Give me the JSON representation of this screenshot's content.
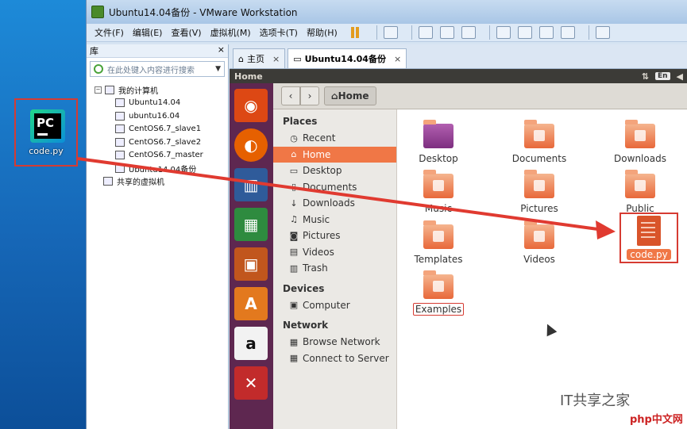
{
  "desktop": {
    "icon_label": "code.py",
    "icon_text": "PC"
  },
  "window": {
    "title": "Ubuntu14.04备份 - VMware Workstation"
  },
  "menubar": {
    "items": [
      "文件(F)",
      "编辑(E)",
      "查看(V)",
      "虚拟机(M)",
      "选项卡(T)",
      "帮助(H)"
    ]
  },
  "library": {
    "title": "库",
    "close": "×",
    "search_placeholder": "在此处键入内容进行搜索",
    "root": "我的计算机",
    "vms": [
      "Ubuntu14.04",
      "ubuntu16.04",
      "CentOS6.7_slave1",
      "CentOS6.7_slave2",
      "CentOS6.7_master",
      "Ubuntu14.04备份"
    ],
    "shared": "共享的虚拟机"
  },
  "tabs": [
    {
      "label": "主页",
      "close": "×"
    },
    {
      "label": "Ubuntu14.04备份",
      "close": "×"
    }
  ],
  "ubuntu": {
    "topbar_title": "Home",
    "lang": "En"
  },
  "nautilus": {
    "crumb": "Home",
    "places_title": "Places",
    "places": [
      "Recent",
      "Home",
      "Desktop",
      "Documents",
      "Downloads",
      "Music",
      "Pictures",
      "Videos",
      "Trash"
    ],
    "devices_title": "Devices",
    "devices": [
      "Computer"
    ],
    "network_title": "Network",
    "network": [
      "Browse Network",
      "Connect to Server"
    ],
    "files": [
      "Desktop",
      "Documents",
      "Downloads",
      "Music",
      "Pictures",
      "Public",
      "Templates",
      "Videos",
      "code.py",
      "Examples"
    ]
  },
  "watermark": {
    "text": "IT共享之家",
    "site": "php中文网"
  }
}
